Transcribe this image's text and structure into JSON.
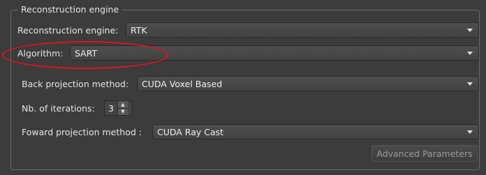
{
  "group": {
    "title": "Reconstruction engine"
  },
  "fields": {
    "engine": {
      "label": "Reconstruction engine:",
      "value": "RTK"
    },
    "algorithm": {
      "label": "Algorithm:",
      "value": "SART"
    },
    "back_projection": {
      "label": "Back projection method:",
      "value": "CUDA Voxel Based"
    },
    "iterations": {
      "label": "Nb. of iterations:",
      "value": "3"
    },
    "forward_projection": {
      "label": "Foward projection method :",
      "value": "CUDA Ray Cast"
    }
  },
  "buttons": {
    "advanced": "Advanced Parameters"
  },
  "colors": {
    "highlight": "#e0141c",
    "background": "#3c3c3c"
  },
  "icons": [
    "dropdown-arrow-icon",
    "spin-up-icon",
    "spin-down-icon"
  ]
}
